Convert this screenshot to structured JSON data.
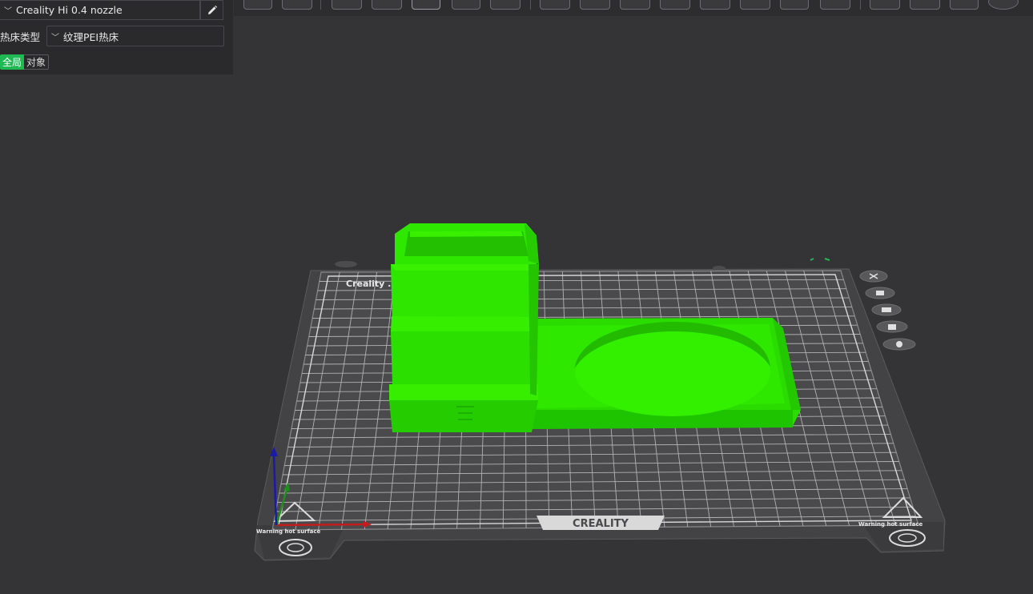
{
  "printer": {
    "name": "Creality Hi 0.4 nozzle",
    "dropdown_icon": "chevron-down-icon",
    "edit_icon": "pencil-icon"
  },
  "bed": {
    "label": "热床类型",
    "value": "纹理PEI热床"
  },
  "scope": {
    "global": "全局",
    "object": "对象"
  },
  "plate": {
    "top_label": "Creality ... ate",
    "brand": "CREALITY",
    "warning_left": "Warning hot surface",
    "warning_right": "Warning hot surface",
    "side_icons": [
      "close-icon",
      "arrange-icon",
      "orient-icon",
      "lock-icon",
      "settings-icon"
    ]
  },
  "colors": {
    "model": "#22e600",
    "accent": "#1fb954",
    "plate": "#454545",
    "background": "#343436"
  }
}
